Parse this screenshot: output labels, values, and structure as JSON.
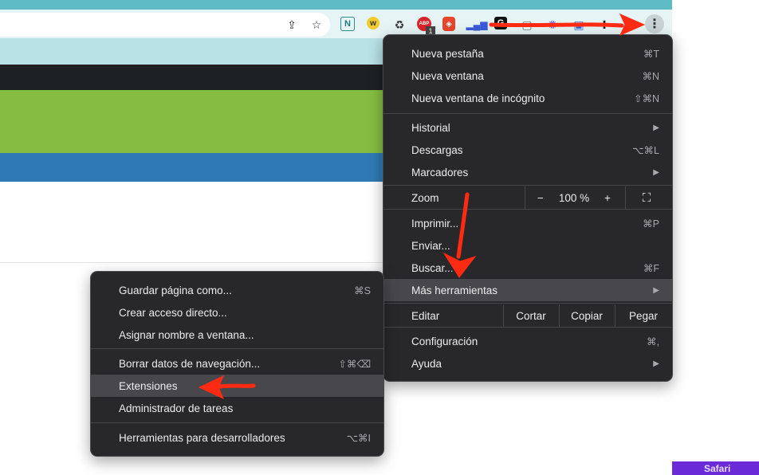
{
  "chrome": {
    "tab_badge": "1",
    "kebab_glyph": "⋮",
    "extension_icons": [
      "share-icon",
      "star-icon",
      "notion-extension-icon",
      "w-extension-icon",
      "recycle-extension-icon",
      "abp-extension-icon",
      "brave-shield-icon",
      "signal-bars-icon",
      "g-extension-icon",
      "square-extension-icon",
      "spark-extension-icon",
      "bookmark-extension-icon",
      "puzzle-icon"
    ]
  },
  "main_menu": {
    "items": [
      {
        "label": "Nueva pestaña",
        "shortcut": "⌘T"
      },
      {
        "label": "Nueva ventana",
        "shortcut": "⌘N"
      },
      {
        "label": "Nueva ventana de incógnito",
        "shortcut": "⇧⌘N"
      },
      {
        "label": "Historial",
        "arrow": "▶"
      },
      {
        "label": "Descargas",
        "shortcut": "⌥⌘L"
      },
      {
        "label": "Marcadores",
        "arrow": "▶"
      },
      {
        "label": "Imprimir...",
        "shortcut": "⌘P"
      },
      {
        "label": "Enviar...",
        "shortcut": ""
      },
      {
        "label": "Buscar...",
        "shortcut": "⌘F"
      },
      {
        "label": "Más herramientas",
        "arrow": "▶"
      },
      {
        "label": "Configuración",
        "shortcut": "⌘,"
      },
      {
        "label": "Ayuda",
        "arrow": "▶"
      }
    ],
    "zoom": {
      "label": "Zoom",
      "minus": "−",
      "value": "100 %",
      "plus": "+",
      "fullscreen": "⛶"
    },
    "edit": {
      "label": "Editar",
      "cut": "Cortar",
      "copy": "Copiar",
      "paste": "Pegar"
    }
  },
  "sub_menu": {
    "items": [
      {
        "label": "Guardar página como...",
        "shortcut": "⌘S"
      },
      {
        "label": "Crear acceso directo...",
        "shortcut": ""
      },
      {
        "label": "Asignar nombre a ventana...",
        "shortcut": ""
      },
      {
        "label": "Borrar datos de navegación...",
        "shortcut": "⇧⌘⌫"
      },
      {
        "label": "Extensiones",
        "shortcut": ""
      },
      {
        "label": "Administrador de tareas",
        "shortcut": ""
      },
      {
        "label": "Herramientas para desarrolladores",
        "shortcut": "⌥⌘I"
      }
    ]
  },
  "watermark": {
    "apple": "",
    "label": "Safari"
  },
  "colors": {
    "menu_bg": "#28282b",
    "highlight": "#48484c",
    "arrow": "#ff2a12",
    "accent_band": "#85bd41"
  }
}
